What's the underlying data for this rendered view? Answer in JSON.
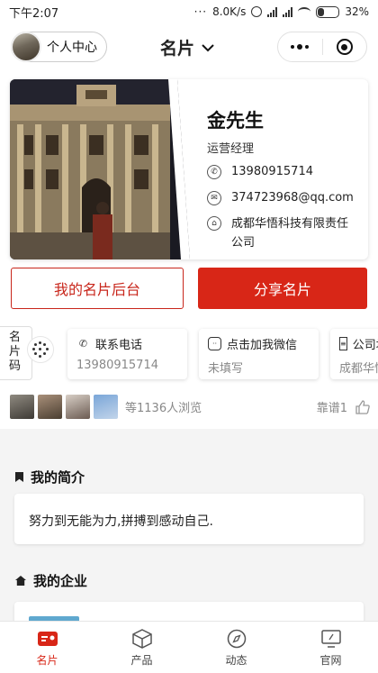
{
  "status_bar": {
    "time": "下午2:07",
    "network_speed": "8.0K/s",
    "battery": "32%",
    "battery_level": 0.32
  },
  "navbar": {
    "personal_center": "个人中心",
    "title": "名片",
    "icons": [
      "chevron-down-icon",
      "more-dots-icon",
      "close-target-icon"
    ]
  },
  "card": {
    "name": "金先生",
    "position": "运营经理",
    "phone": "13980915714",
    "email": "374723968@qq.com",
    "company": "成都华悟科技有限责任公司"
  },
  "actions": {
    "backend": "我的名片后台",
    "share": "分享名片"
  },
  "qr_tab": {
    "label": "名片码"
  },
  "contacts": [
    {
      "label": "联系电话",
      "value": "13980915714",
      "icon": "phone-icon"
    },
    {
      "label": "点击加我微信",
      "value": "未填写",
      "icon": "wechat-icon"
    },
    {
      "label": "公司地址",
      "value": "成都华悟科技",
      "icon": "building-icon"
    }
  ],
  "viewers": {
    "text": "等1136人浏览"
  },
  "likes": {
    "text": "靠谱1"
  },
  "intro": {
    "heading": "我的简介",
    "content": "努力到无能为力,拼搏到感动自己."
  },
  "enterprise": {
    "heading": "我的企业"
  },
  "tabbar": {
    "items": [
      {
        "label": "名片",
        "icon": "card-icon",
        "active": true
      },
      {
        "label": "产品",
        "icon": "box-icon",
        "active": false
      },
      {
        "label": "动态",
        "icon": "compass-icon",
        "active": false
      },
      {
        "label": "官网",
        "icon": "monitor-icon",
        "active": false
      }
    ]
  },
  "colors": {
    "accent": "#d82617",
    "muted_text": "#888888"
  }
}
